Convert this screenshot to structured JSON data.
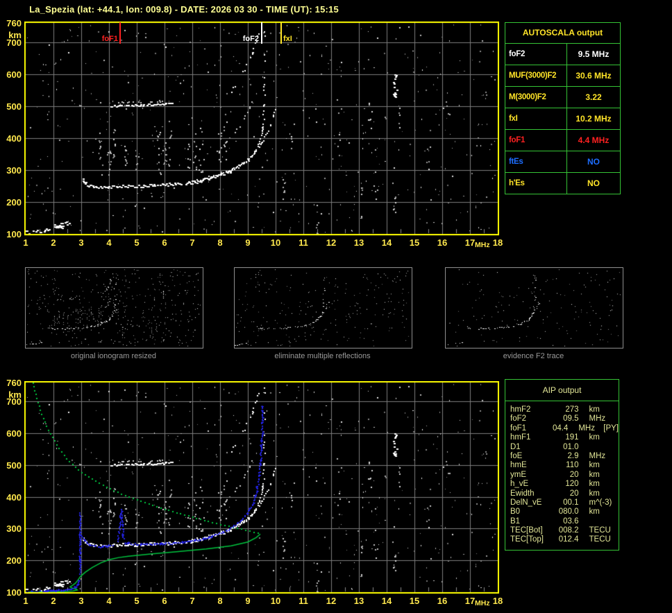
{
  "title": "La_Spezia (lat: +44.1, lon: 009.8) - DATE: 2026 03 30 - TIME (UT): 15:15",
  "colors": {
    "background": "#000000",
    "plot_border": "#ffff00",
    "grid": "#7d7d7d",
    "half_tick": "#8a8a8a",
    "axis_text": "#ffe84d",
    "title_text": "#ffff93",
    "table_border": "#35c435",
    "caption": "#9a9a9a",
    "trace_white": "#ffffff",
    "profile_green": "#00c53e",
    "restored_blue": "#2323e6",
    "marker_red": "#ff2121",
    "value_blue": "#1d6dff",
    "value_yellow": "#ffe428",
    "aip_text": "#e2e697"
  },
  "axis": {
    "x_ticks": [
      1,
      2,
      3,
      4,
      5,
      6,
      7,
      8,
      9,
      10,
      11,
      12,
      13,
      14,
      15,
      16,
      17,
      18
    ],
    "x_unit": "MHz",
    "y_ticks": [
      760,
      700,
      600,
      500,
      400,
      300,
      200,
      100
    ],
    "y_unit": "km"
  },
  "autoscala": {
    "header": "AUTOSCALA output",
    "rows": [
      {
        "label": "foF2",
        "value": "9.5 MHz",
        "color": "#ffffff"
      },
      {
        "label": "MUF(3000)F2",
        "value": "30.6 MHz",
        "color": "#ffe428"
      },
      {
        "label": "M(3000)F2",
        "value": "3.22",
        "color": "#ffe428"
      },
      {
        "label": "fxI",
        "value": "10.2 MHz",
        "color": "#ffe428"
      },
      {
        "label": "foF1",
        "value": "4.4 MHz",
        "color": "#ff2121"
      },
      {
        "label": "ftEs",
        "value": "NO",
        "color": "#1d6dff"
      },
      {
        "label": "h'Es",
        "value": "NO",
        "color": "#ffe428"
      }
    ]
  },
  "aip": {
    "header": "AIP output",
    "rows": [
      {
        "label": "hmF2",
        "value": "273",
        "unit": "km",
        "note": ""
      },
      {
        "label": "foF2",
        "value": "09.5",
        "unit": "MHz",
        "note": ""
      },
      {
        "label": "foF1",
        "value": "04.4",
        "unit": "MHz",
        "note": "[PY]"
      },
      {
        "label": "hmF1",
        "value": "191",
        "unit": "km",
        "note": ""
      },
      {
        "label": "D1",
        "value": "01.0",
        "unit": "",
        "note": ""
      },
      {
        "label": "foE",
        "value": "2.9",
        "unit": "MHz",
        "note": ""
      },
      {
        "label": "hmE",
        "value": "110",
        "unit": "km",
        "note": ""
      },
      {
        "label": "ymE",
        "value": "20",
        "unit": "km",
        "note": ""
      },
      {
        "label": "h_vE",
        "value": "120",
        "unit": "km",
        "note": ""
      },
      {
        "label": "Ewidth",
        "value": "20",
        "unit": "km",
        "note": ""
      },
      {
        "label": "DelN_vE",
        "value": "00.1",
        "unit": "m^(-3)",
        "note": ""
      },
      {
        "label": "B0",
        "value": "080.0",
        "unit": "km",
        "note": ""
      },
      {
        "label": "B1",
        "value": "03.6",
        "unit": "",
        "note": ""
      },
      {
        "label": "TEC[Bot]",
        "value": "008.2",
        "unit": "TECU",
        "note": ""
      },
      {
        "label": "TEC[Top]",
        "value": "012.4",
        "unit": "TECU",
        "note": ""
      }
    ]
  },
  "thumbnails": [
    {
      "caption": "original ionogram resized"
    },
    {
      "caption": "eliminate multiple reflections"
    },
    {
      "caption": "evidence F2 trace"
    }
  ],
  "chart_data": [
    {
      "id": "ionogram-top",
      "type": "scatter",
      "xlabel": "MHz",
      "ylabel": "km",
      "xlim": [
        1,
        18
      ],
      "ylim": [
        100,
        760
      ],
      "grid": true,
      "markers": [
        {
          "label": "foF1",
          "mhz": 4.4,
          "color": "#ff2121"
        },
        {
          "label": "foF2",
          "mhz": 9.5,
          "color": "#ffffff"
        },
        {
          "label": "fxI",
          "mhz": 10.2,
          "color": "#ffe428"
        }
      ],
      "series": [
        {
          "name": "E-trace",
          "color": "#ffffff",
          "points": [
            [
              1.0,
              106
            ],
            [
              1.3,
              108
            ],
            [
              1.6,
              111
            ],
            [
              1.9,
              115
            ],
            [
              2.2,
              121
            ],
            [
              2.45,
              128
            ],
            [
              2.6,
              134
            ]
          ]
        },
        {
          "name": "E-blob",
          "color": "#ffffff",
          "points": [
            [
              2.05,
              127
            ],
            [
              2.3,
              130
            ],
            [
              2.55,
              133
            ]
          ]
        },
        {
          "name": "F-ordinary",
          "color": "#ffffff",
          "points": [
            [
              3.05,
              272
            ],
            [
              3.12,
              260
            ],
            [
              3.25,
              252
            ],
            [
              3.45,
              248
            ],
            [
              3.8,
              247
            ],
            [
              4.3,
              249
            ],
            [
              4.9,
              250
            ],
            [
              5.5,
              252
            ],
            [
              6.0,
              254
            ],
            [
              6.5,
              257
            ],
            [
              7.0,
              262
            ],
            [
              7.4,
              269
            ],
            [
              7.8,
              278
            ],
            [
              8.2,
              290
            ],
            [
              8.6,
              306
            ],
            [
              8.95,
              326
            ],
            [
              9.2,
              350
            ],
            [
              9.38,
              378
            ],
            [
              9.5,
              412
            ],
            [
              9.55,
              450
            ],
            [
              9.57,
              495
            ],
            [
              9.58,
              545
            ],
            [
              9.59,
              600
            ],
            [
              9.6,
              655
            ],
            [
              9.6,
              705
            ],
            [
              9.6,
              745
            ]
          ]
        },
        {
          "name": "F-extraordinary",
          "color": "#ffffff",
          "points": [
            [
              6.9,
              265
            ],
            [
              7.3,
              271
            ],
            [
              7.7,
              280
            ],
            [
              8.1,
              291
            ],
            [
              8.5,
              306
            ],
            [
              8.85,
              325
            ],
            [
              9.15,
              348
            ],
            [
              9.4,
              374
            ],
            [
              9.6,
              402
            ],
            [
              9.77,
              432
            ],
            [
              9.9,
              462
            ],
            [
              10.0,
              492
            ],
            [
              10.05,
              515
            ]
          ]
        },
        {
          "name": "second-hop-flat",
          "color": "#ffffff",
          "points": [
            [
              4.05,
              500
            ],
            [
              4.6,
              502
            ],
            [
              5.2,
              504
            ],
            [
              5.8,
              506
            ],
            [
              6.3,
              508
            ]
          ]
        },
        {
          "name": "second-hop-flat2",
          "color": "#dddddd",
          "points": [
            [
              4.3,
              511
            ],
            [
              5.0,
              513
            ],
            [
              5.8,
              515
            ],
            [
              6.2,
              516
            ]
          ]
        },
        {
          "name": "second-hop-rise",
          "color": "#ffffff",
          "points": [
            [
              8.4,
              545
            ],
            [
              8.65,
              578
            ],
            [
              8.9,
              618
            ],
            [
              9.1,
              658
            ],
            [
              9.28,
              700
            ],
            [
              9.4,
              738
            ]
          ]
        },
        {
          "name": "mid-multiple-faint",
          "color": "#e0e0e0",
          "points": [
            [
              7.3,
              325
            ],
            [
              7.7,
              346
            ],
            [
              8.05,
              372
            ],
            [
              8.4,
              403
            ],
            [
              8.7,
              438
            ],
            [
              8.95,
              475
            ],
            [
              9.15,
              515
            ]
          ]
        }
      ],
      "noise": {
        "seed": 42,
        "specks": 560,
        "columns": [
          {
            "m": 3.7,
            "k0": 280,
            "k1": 420,
            "n": 10
          },
          {
            "m": 4.0,
            "k0": 280,
            "k1": 360,
            "n": 8
          },
          {
            "m": 4.2,
            "k0": 290,
            "k1": 430,
            "n": 9
          },
          {
            "m": 4.6,
            "k0": 280,
            "k1": 380,
            "n": 8
          },
          {
            "m": 5.0,
            "k0": 290,
            "k1": 360,
            "n": 6
          },
          {
            "m": 5.8,
            "k0": 280,
            "k1": 420,
            "n": 10
          },
          {
            "m": 6.0,
            "k0": 290,
            "k1": 380,
            "n": 8
          },
          {
            "m": 6.2,
            "k0": 300,
            "k1": 430,
            "n": 8
          },
          {
            "m": 6.9,
            "k0": 280,
            "k1": 400,
            "n": 7
          },
          {
            "m": 7.1,
            "k0": 300,
            "k1": 420,
            "n": 8
          },
          {
            "m": 7.3,
            "k0": 290,
            "k1": 440,
            "n": 9
          },
          {
            "m": 8.0,
            "k0": 290,
            "k1": 460,
            "n": 10
          },
          {
            "m": 8.2,
            "k0": 300,
            "k1": 480,
            "n": 8
          },
          {
            "m": 10.3,
            "k0": 180,
            "k1": 280,
            "n": 6
          },
          {
            "m": 10.6,
            "k0": 350,
            "k1": 450,
            "n": 5
          },
          {
            "m": 11.5,
            "k0": 100,
            "k1": 160,
            "n": 5
          },
          {
            "m": 12.3,
            "k0": 340,
            "k1": 420,
            "n": 4
          },
          {
            "m": 13.1,
            "k0": 150,
            "k1": 250,
            "n": 6
          },
          {
            "m": 13.4,
            "k0": 430,
            "k1": 520,
            "n": 7
          },
          {
            "m": 13.6,
            "k0": 200,
            "k1": 300,
            "n": 5
          },
          {
            "m": 14.3,
            "k0": 515,
            "k1": 605,
            "n": 14,
            "bright": true
          },
          {
            "m": 14.45,
            "k0": 430,
            "k1": 500,
            "n": 6
          },
          {
            "m": 14.3,
            "k0": 140,
            "k1": 220,
            "n": 7
          },
          {
            "m": 15.5,
            "k0": 300,
            "k1": 380,
            "n": 5
          },
          {
            "m": 16.2,
            "k0": 440,
            "k1": 520,
            "n": 5
          }
        ]
      }
    },
    {
      "id": "ionogram-bottom",
      "type": "scatter",
      "xlabel": "MHz",
      "ylabel": "km",
      "xlim": [
        1,
        18
      ],
      "ylim": [
        100,
        760
      ],
      "grid": true,
      "markers": [],
      "overlays": {
        "profile_color": "#00c53e",
        "restored_color": "#2323e6",
        "profile_topside_dotted": [
          [
            1.25,
            760
          ],
          [
            1.38,
            715
          ],
          [
            1.55,
            665
          ],
          [
            1.78,
            615
          ],
          [
            2.1,
            565
          ],
          [
            2.5,
            518
          ],
          [
            3.0,
            478
          ],
          [
            3.6,
            445
          ],
          [
            4.3,
            415
          ],
          [
            5.1,
            388
          ],
          [
            6.0,
            362
          ],
          [
            7.0,
            337
          ],
          [
            8.0,
            314
          ],
          [
            8.8,
            298
          ],
          [
            9.3,
            288
          ],
          [
            9.45,
            283
          ]
        ],
        "profile_bottomside": [
          [
            9.45,
            283
          ],
          [
            9.3,
            272
          ],
          [
            9.0,
            258
          ],
          [
            8.4,
            246
          ],
          [
            7.5,
            236
          ],
          [
            6.5,
            228
          ],
          [
            5.5,
            220
          ],
          [
            4.7,
            213
          ],
          [
            4.35,
            209
          ],
          [
            4.0,
            202
          ],
          [
            3.7,
            192
          ],
          [
            3.4,
            178
          ],
          [
            3.15,
            163
          ],
          [
            2.98,
            150
          ],
          [
            2.88,
            138
          ],
          [
            2.79,
            128
          ],
          [
            2.68,
            121
          ],
          [
            2.6,
            117
          ],
          [
            2.66,
            113
          ],
          [
            2.82,
            110
          ],
          [
            2.86,
            107
          ],
          [
            2.7,
            104
          ],
          [
            2.4,
            102
          ],
          [
            2.0,
            101
          ],
          [
            1.6,
            100.5
          ],
          [
            1.1,
            100.5
          ]
        ],
        "restored": [
          [
            [
              1.02,
              101
            ],
            [
              1.35,
              102
            ],
            [
              1.7,
              103
            ],
            [
              2.05,
              105
            ],
            [
              2.35,
              107
            ],
            [
              2.6,
              110
            ],
            [
              2.75,
              114
            ],
            [
              2.85,
              121
            ],
            [
              2.9,
              131
            ],
            [
              2.93,
              142
            ]
          ],
          [
            [
              2.95,
              160
            ],
            [
              2.95,
              355
            ]
          ],
          [
            [
              3.0,
              280
            ],
            [
              3.08,
              265
            ],
            [
              3.2,
              254
            ],
            [
              3.4,
              247
            ],
            [
              3.7,
              244
            ],
            [
              4.0,
              246
            ],
            [
              4.2,
              250
            ]
          ],
          [
            [
              4.3,
              262
            ],
            [
              4.36,
              290
            ],
            [
              4.4,
              325
            ],
            [
              4.43,
              358
            ],
            [
              4.46,
              325
            ],
            [
              4.49,
              290
            ],
            [
              4.52,
              265
            ]
          ],
          [
            [
              4.6,
              255
            ],
            [
              5.0,
              251
            ],
            [
              5.5,
              251
            ],
            [
              6.0,
              253
            ],
            [
              6.5,
              256
            ],
            [
              7.0,
              261
            ],
            [
              7.5,
              270
            ],
            [
              7.9,
              282
            ],
            [
              8.3,
              298
            ],
            [
              8.7,
              322
            ],
            [
              9.0,
              350
            ],
            [
              9.2,
              382
            ],
            [
              9.33,
              425
            ],
            [
              9.42,
              475
            ],
            [
              9.47,
              530
            ],
            [
              9.5,
              585
            ],
            [
              9.52,
              640
            ],
            [
              9.53,
              690
            ]
          ]
        ]
      }
    }
  ]
}
